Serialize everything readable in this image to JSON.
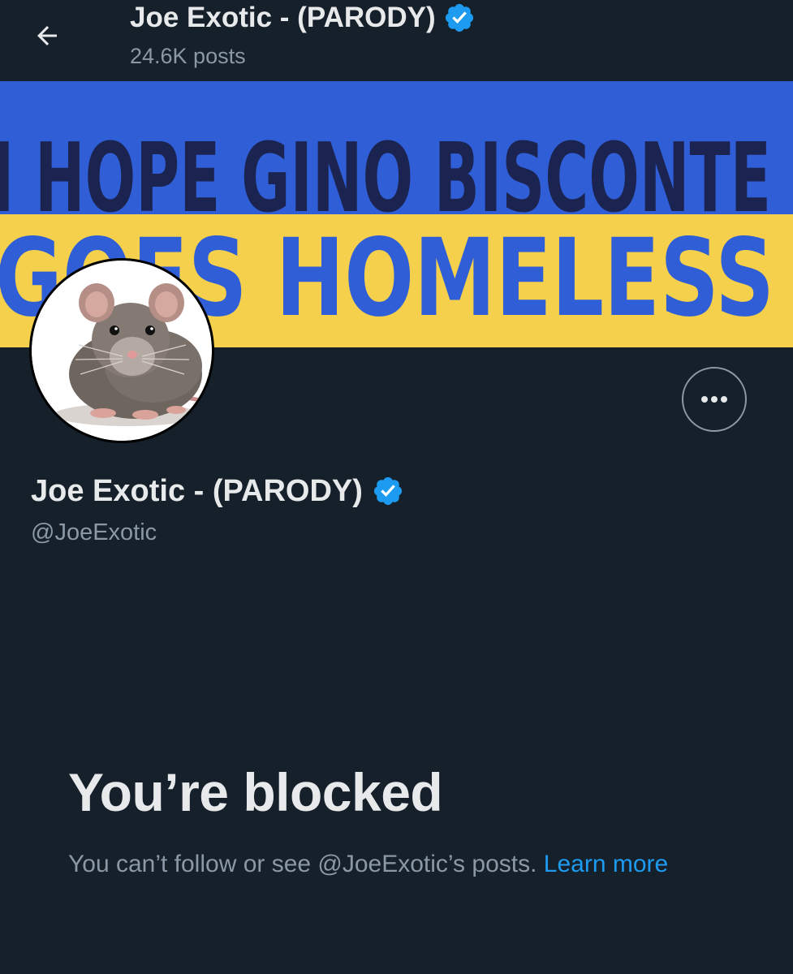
{
  "header": {
    "title": "Joe Exotic - (PARODY)",
    "posts_count": "24.6K posts"
  },
  "banner": {
    "line1": "I HOPE GINO BISCONTE",
    "line2": "GOES HOMELESS",
    "colors": {
      "top": "#2f5ed6",
      "bottom": "#f5d04d"
    }
  },
  "profile": {
    "display_name": "Joe Exotic - (PARODY)",
    "handle": "@JoeExotic",
    "verified": true,
    "avatar_subject": "rat"
  },
  "blocked": {
    "title": "You’re blocked",
    "description": "You can’t follow or see @JoeExotic’s posts.",
    "link_label": "Learn more"
  },
  "icons": {
    "back": "arrow-left-icon",
    "verified": "verified-badge-icon",
    "more": "more-horizontal-icon"
  },
  "colors": {
    "background": "#15202b",
    "text_primary": "#e7e9ea",
    "text_secondary": "#8b98a5",
    "accent": "#1d9bf0"
  }
}
